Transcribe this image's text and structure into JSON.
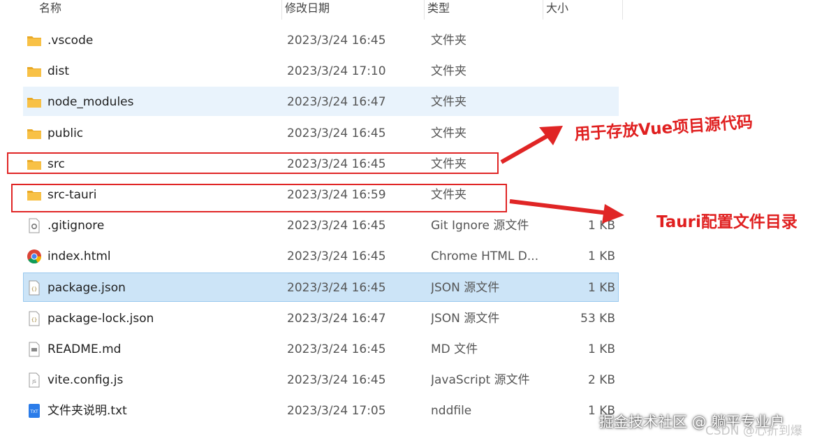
{
  "columns": {
    "name": "名称",
    "date": "修改日期",
    "type": "类型",
    "size": "大小"
  },
  "files": [
    {
      "name": ".vscode",
      "date": "2023/3/24 16:45",
      "type": "文件夹",
      "size": "",
      "icon": "folder-icon",
      "state": ""
    },
    {
      "name": "dist",
      "date": "2023/3/24 17:10",
      "type": "文件夹",
      "size": "",
      "icon": "folder-icon",
      "state": ""
    },
    {
      "name": "node_modules",
      "date": "2023/3/24 16:47",
      "type": "文件夹",
      "size": "",
      "icon": "folder-icon",
      "state": "hover"
    },
    {
      "name": "public",
      "date": "2023/3/24 16:45",
      "type": "文件夹",
      "size": "",
      "icon": "folder-icon",
      "state": ""
    },
    {
      "name": "src",
      "date": "2023/3/24 16:45",
      "type": "文件夹",
      "size": "",
      "icon": "folder-icon",
      "state": ""
    },
    {
      "name": "src-tauri",
      "date": "2023/3/24 16:59",
      "type": "文件夹",
      "size": "",
      "icon": "folder-icon",
      "state": ""
    },
    {
      "name": ".gitignore",
      "date": "2023/3/24 16:45",
      "type": "Git Ignore 源文件",
      "size": "1 KB",
      "icon": "settings-file-icon",
      "state": ""
    },
    {
      "name": "index.html",
      "date": "2023/3/24 16:45",
      "type": "Chrome HTML D...",
      "size": "1 KB",
      "icon": "chrome-icon",
      "state": ""
    },
    {
      "name": "package.json",
      "date": "2023/3/24 16:45",
      "type": "JSON 源文件",
      "size": "1 KB",
      "icon": "json-file-icon",
      "state": "selected"
    },
    {
      "name": "package-lock.json",
      "date": "2023/3/24 16:47",
      "type": "JSON 源文件",
      "size": "53 KB",
      "icon": "json-file-icon",
      "state": ""
    },
    {
      "name": "README.md",
      "date": "2023/3/24 16:45",
      "type": "MD 文件",
      "size": "1 KB",
      "icon": "markdown-file-icon",
      "state": ""
    },
    {
      "name": "vite.config.js",
      "date": "2023/3/24 16:45",
      "type": "JavaScript 源文件",
      "size": "2 KB",
      "icon": "js-file-icon",
      "state": ""
    },
    {
      "name": "文件夹说明.txt",
      "date": "2023/3/24 17:05",
      "type": "nddfile",
      "size": "1 KB",
      "icon": "txt-file-icon",
      "state": ""
    }
  ],
  "annotations": {
    "src_note": "用于存放Vue项目源代码",
    "tauri_note": "Tauri配置文件目录"
  },
  "watermark": {
    "juejin": "掘金技术社区 @ 躺平专业户",
    "csdn": "CSDN @心折到爆"
  },
  "colors": {
    "annotation_red": "#e02020",
    "hover_bg": "#e9f3fc",
    "selected_bg": "#cce4f7",
    "folder": "#f8c146"
  }
}
